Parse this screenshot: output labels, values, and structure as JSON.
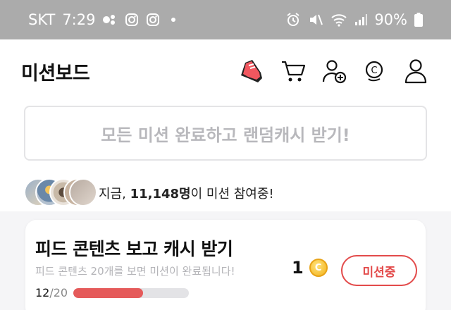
{
  "status_bar": {
    "carrier": "SKT",
    "time": "7:29",
    "battery": "90%",
    "icons": [
      "link-icon",
      "instagram-icon",
      "instagram-icon",
      "alarm-icon",
      "mute-icon",
      "wifi-icon",
      "signal-icon",
      "battery-icon"
    ]
  },
  "header": {
    "title": "미션보드",
    "icons": [
      "shoe-icon",
      "cart-icon",
      "add-friend-icon",
      "cash-icon",
      "profile-icon"
    ]
  },
  "banner": {
    "text": "모든 미션 완료하고 랜덤캐시 받기!"
  },
  "participants": {
    "prefix": "지금, ",
    "count": "11,148명",
    "suffix": "이 미션 참여중!"
  },
  "mission": {
    "title": "피드 콘텐츠 보고 캐시 받기",
    "description": "피드 콘텐츠 20개를 보면 미션이 완료됩니다!",
    "reward": "1",
    "coin_symbol": "C",
    "button": "미션중",
    "progress_current": "12",
    "progress_total": "/20",
    "progress_fraction": 0.6
  },
  "colors": {
    "accent": "#e34b4b",
    "progress": "#e55a5a",
    "coin": "#f3b31c"
  }
}
